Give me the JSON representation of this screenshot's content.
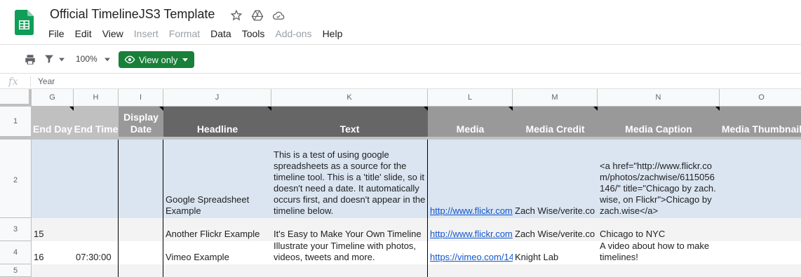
{
  "app": {
    "title": "Official TimelineJS3 Template"
  },
  "menu": [
    "File",
    "Edit",
    "View",
    "Insert",
    "Format",
    "Data",
    "Tools",
    "Add-ons",
    "Help"
  ],
  "toolbar": {
    "zoom": "100%",
    "view_only": "View only"
  },
  "formula": {
    "fx": "fx",
    "value": "Year"
  },
  "columns": [
    "G",
    "H",
    "I",
    "J",
    "K",
    "L",
    "M",
    "N",
    "O"
  ],
  "rows": [
    "1",
    "2",
    "3",
    "4",
    "5"
  ],
  "headers": {
    "g": "End Day",
    "h": "End Time",
    "i": "Display Date",
    "j": "Headline",
    "k": "Text",
    "l": "Media",
    "m": "Media Credit",
    "n": "Media Caption",
    "o": "Media Thumbnail"
  },
  "data": {
    "r2": {
      "j": "Google Spreadsheet Example",
      "k": "This is a test of using google spreadsheets as a source for the timeline tool. This is a 'title' slide, so it doesn't need a date. It automatically occurs first, and doesn't appear in the timeline below.",
      "l": "http://www.flickr.com",
      "m": "Zach Wise/verite.co",
      "n": "<a href=\"http://www.flickr.com/photos/zachwise/6115056146/\" title=\"Chicago by zach.wise, on Flickr\">Chicago by zach.wise</a>"
    },
    "r3": {
      "g": "15",
      "j": "Another Flickr Example",
      "k": "It's Easy to Make Your Own Timeline",
      "l": "http://www.flickr.com",
      "m": "Zach Wise/verite.co",
      "n": "Chicago to NYC"
    },
    "r4": {
      "g": "16",
      "h": "07:30:00",
      "j": "Vimeo Example",
      "k": "Illustrate your Timeline with photos, videos, tweets and more.",
      "l": "https://vimeo.com/14",
      "m": "Knight Lab",
      "n": "A video about how to make timelines!"
    }
  },
  "colors": {
    "accent": "#188038",
    "header_light": "#c0c0c0",
    "header_dark": "#666666",
    "header_mid": "#999999",
    "row2": "#dbe5f1",
    "row3": "#f3f3f3"
  },
  "icons": [
    "sheets-logo-icon",
    "star-icon",
    "drive-icon",
    "cloud-icon",
    "print-icon",
    "filter-icon",
    "chevron-down-icon",
    "eye-icon"
  ]
}
